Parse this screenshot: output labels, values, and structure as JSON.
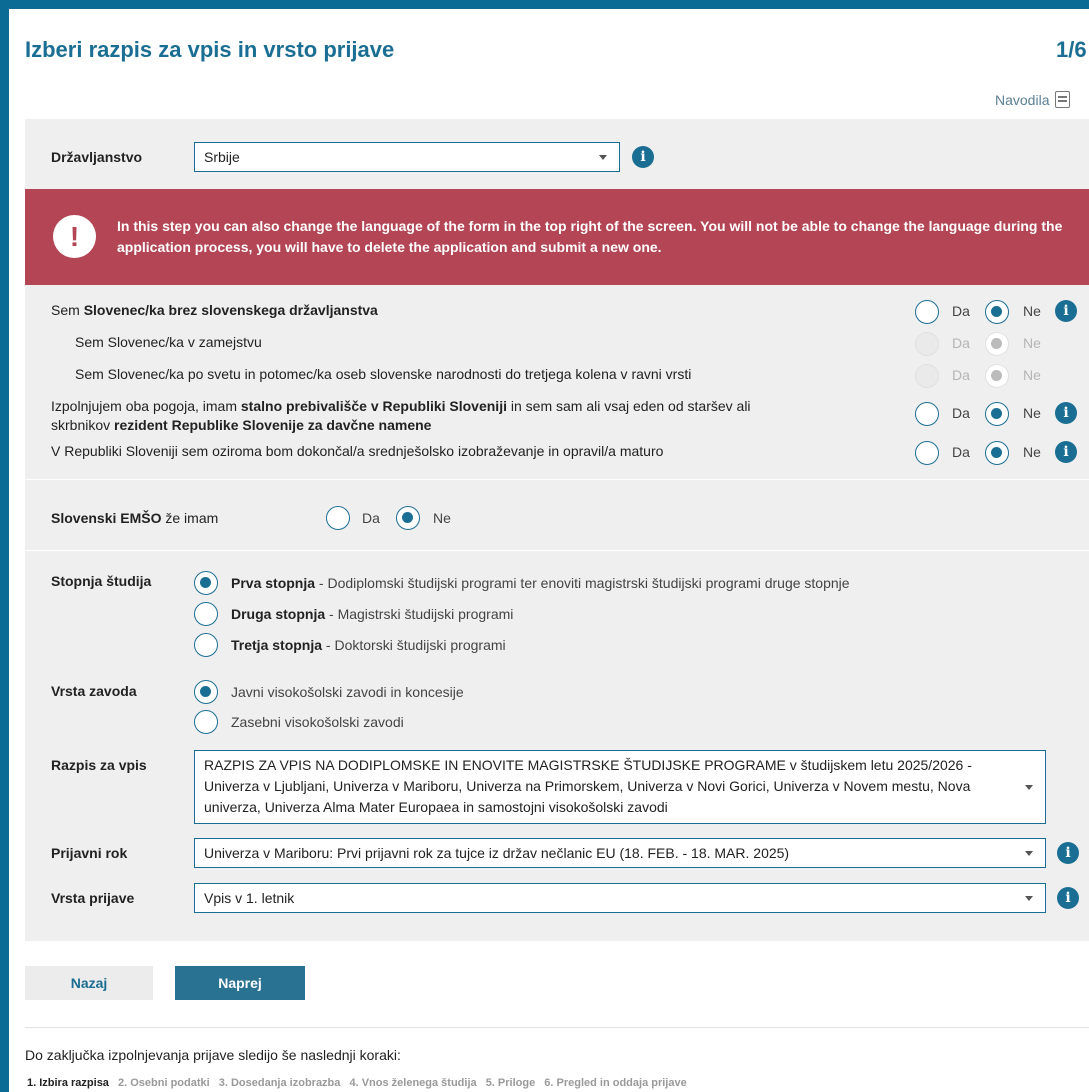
{
  "header": {
    "title": "Izberi razpis za vpis in vrsto prijave",
    "step_counter": "1/6",
    "help_label": "Navodila"
  },
  "citizenship": {
    "label": "Državljanstvo",
    "value": "Srbije"
  },
  "alert": {
    "icon": "exclamation-icon",
    "message": "In this step you can also change the language of the form in the top right of the screen. You will not be able to change the language during the application process, you will have to delete the application and submit a new one."
  },
  "status": {
    "q1": {
      "pre": "Sem ",
      "bold": "Slovenec/ka brez slovenskega državljanstva",
      "yes": "Da",
      "no": "Ne",
      "selected": "Ne"
    },
    "q2": {
      "text": "Sem Slovenec/ka v zamejstvu",
      "yes": "Da",
      "no": "Ne",
      "selected": "Ne",
      "disabled": true
    },
    "q3": {
      "text": "Sem Slovenec/ka po svetu in potomec/ka oseb slovenske narodnosti do tretjega kolena v ravni vrsti",
      "yes": "Da",
      "no": "Ne",
      "selected": "Ne",
      "disabled": true
    },
    "q4": {
      "l1_pre": "Izpolnjujem oba pogoja, imam ",
      "l1_bold": "stalno prebivališče v Republiki Sloveniji",
      "l1_post": " in sem sam ali vsaj eden od staršev ali",
      "l2_pre": "skrbnikov ",
      "l2_bold": "rezident Republike Slovenije za davčne namene",
      "yes": "Da",
      "no": "Ne",
      "selected": "Ne"
    },
    "q5": {
      "text": "V Republiki Sloveniji sem oziroma bom dokončal/a srednješolsko izobraževanje in opravil/a maturo",
      "yes": "Da",
      "no": "Ne",
      "selected": "Ne"
    }
  },
  "emso": {
    "label_bold": "Slovenski EMŠO",
    "label_rest": " že imam",
    "yes": "Da",
    "no": "Ne",
    "selected": "Ne"
  },
  "study_level": {
    "label": "Stopnja študija",
    "selected": "Prva stopnja",
    "options": [
      {
        "bold": "Prva stopnja",
        "rest": " - Dodiplomski študijski programi ter enoviti magistrski študijski programi druge stopnje"
      },
      {
        "bold": "Druga stopnja",
        "rest": " - Magistrski študijski programi"
      },
      {
        "bold": "Tretja stopnja",
        "rest": " - Doktorski študijski programi"
      }
    ]
  },
  "institution_type": {
    "label": "Vrsta zavoda",
    "selected": "Javni visokošolski zavodi in koncesije",
    "options": [
      "Javni visokošolski zavodi in koncesije",
      "Zasebni visokošolski zavodi"
    ]
  },
  "call": {
    "label": "Razpis za vpis",
    "value": "RAZPIS ZA VPIS NA DODIPLOMSKE IN ENOVITE MAGISTRSKE ŠTUDIJSKE PROGRAME v študijskem letu 2025/2026 - Univerza v Ljubljani, Univerza v Mariboru, Univerza na Primorskem, Univerza v Novi Gorici, Univerza v Novem mestu, Nova univerza, Univerza Alma Mater Europaea in samostojni visokošolski zavodi"
  },
  "deadline": {
    "label": "Prijavni rok",
    "value": "Univerza v Mariboru: Prvi prijavni rok za tujce iz držav nečlanic EU (18. FEB. - 18. MAR. 2025)"
  },
  "application_type": {
    "label": "Vrsta prijave",
    "value": "Vpis v 1. letnik"
  },
  "buttons": {
    "back": "Nazaj",
    "next": "Naprej"
  },
  "footer": {
    "intro": "Do zaključka izpolnjevanja prijave sledijo še naslednji koraki:",
    "steps": [
      "1. Izbira razpisa",
      "2. Osebni podatki",
      "3. Dosedanja izobrazba",
      "4. Vnos želenega študija",
      "5. Priloge",
      "6. Pregled in oddaja prijave"
    ],
    "active_step": 0
  },
  "colors": {
    "frame": "#0b6b94",
    "accent": "#1b6e93",
    "alert": "#b34555",
    "section_bg": "#efefef"
  }
}
